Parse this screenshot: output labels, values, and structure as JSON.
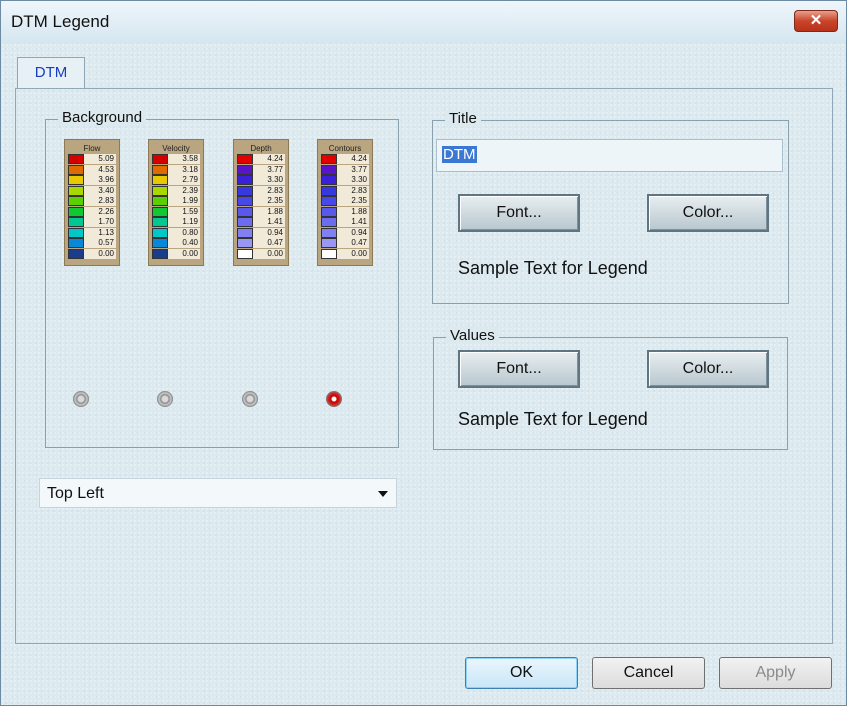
{
  "window": {
    "title": "DTM Legend",
    "close_label": "✕"
  },
  "tabs": [
    {
      "label": "DTM",
      "active": true
    }
  ],
  "background_group": {
    "label": "Background",
    "legends": [
      {
        "title": "Flow",
        "rows": [
          {
            "color": "#d40000",
            "value": "5.09"
          },
          {
            "color": "#e06a00",
            "value": "4.53"
          },
          {
            "color": "#e8c800",
            "value": "3.96"
          },
          {
            "color": "#a8d800",
            "value": "3.40"
          },
          {
            "color": "#5ad000",
            "value": "2.83"
          },
          {
            "color": "#10c830",
            "value": "2.26"
          },
          {
            "color": "#00c890",
            "value": "1.70"
          },
          {
            "color": "#00c8c8",
            "value": "1.13"
          },
          {
            "color": "#0888d8",
            "value": "0.57"
          },
          {
            "color": "#1a3c8c",
            "value": "0.00"
          }
        ]
      },
      {
        "title": "Velocity",
        "rows": [
          {
            "color": "#d40000",
            "value": "3.58"
          },
          {
            "color": "#e06a00",
            "value": "3.18"
          },
          {
            "color": "#e8c800",
            "value": "2.79"
          },
          {
            "color": "#a8d800",
            "value": "2.39"
          },
          {
            "color": "#5ad000",
            "value": "1.99"
          },
          {
            "color": "#10c830",
            "value": "1.59"
          },
          {
            "color": "#00c890",
            "value": "1.19"
          },
          {
            "color": "#00c8c8",
            "value": "0.80"
          },
          {
            "color": "#0888d8",
            "value": "0.40"
          },
          {
            "color": "#1a3c8c",
            "value": "0.00"
          }
        ]
      },
      {
        "title": "Depth",
        "rows": [
          {
            "color": "#e00000",
            "value": "4.24"
          },
          {
            "color": "#5a14c8",
            "value": "3.77"
          },
          {
            "color": "#3a20d8",
            "value": "3.30"
          },
          {
            "color": "#3838e0",
            "value": "2.83"
          },
          {
            "color": "#4848e8",
            "value": "2.35"
          },
          {
            "color": "#5858ec",
            "value": "1.88"
          },
          {
            "color": "#6c6cf0",
            "value": "1.41"
          },
          {
            "color": "#8080f2",
            "value": "0.94"
          },
          {
            "color": "#9898f4",
            "value": "0.47"
          },
          {
            "color": "#ffffff",
            "value": "0.00"
          }
        ]
      },
      {
        "title": "Contours",
        "rows": [
          {
            "color": "#e00000",
            "value": "4.24"
          },
          {
            "color": "#5a14c8",
            "value": "3.77"
          },
          {
            "color": "#3a20d8",
            "value": "3.30"
          },
          {
            "color": "#3838e0",
            "value": "2.83"
          },
          {
            "color": "#4848e8",
            "value": "2.35"
          },
          {
            "color": "#5858ec",
            "value": "1.88"
          },
          {
            "color": "#6c6cf0",
            "value": "1.41"
          },
          {
            "color": "#8080f2",
            "value": "0.94"
          },
          {
            "color": "#9898f4",
            "value": "0.47"
          },
          {
            "color": "#ffffff",
            "value": "0.00"
          }
        ]
      }
    ],
    "selected_index": 3
  },
  "position_select": {
    "value": "Top Left",
    "icon": "chevron-down-icon"
  },
  "title_group": {
    "label": "Title",
    "input_value": "DTM",
    "font_button": "Font...",
    "color_button": "Color...",
    "sample_text": "Sample Text for Legend"
  },
  "values_group": {
    "label": "Values",
    "font_button": "Font...",
    "color_button": "Color...",
    "sample_text": "Sample Text for Legend"
  },
  "footer": {
    "ok": "OK",
    "cancel": "Cancel",
    "apply": "Apply"
  }
}
